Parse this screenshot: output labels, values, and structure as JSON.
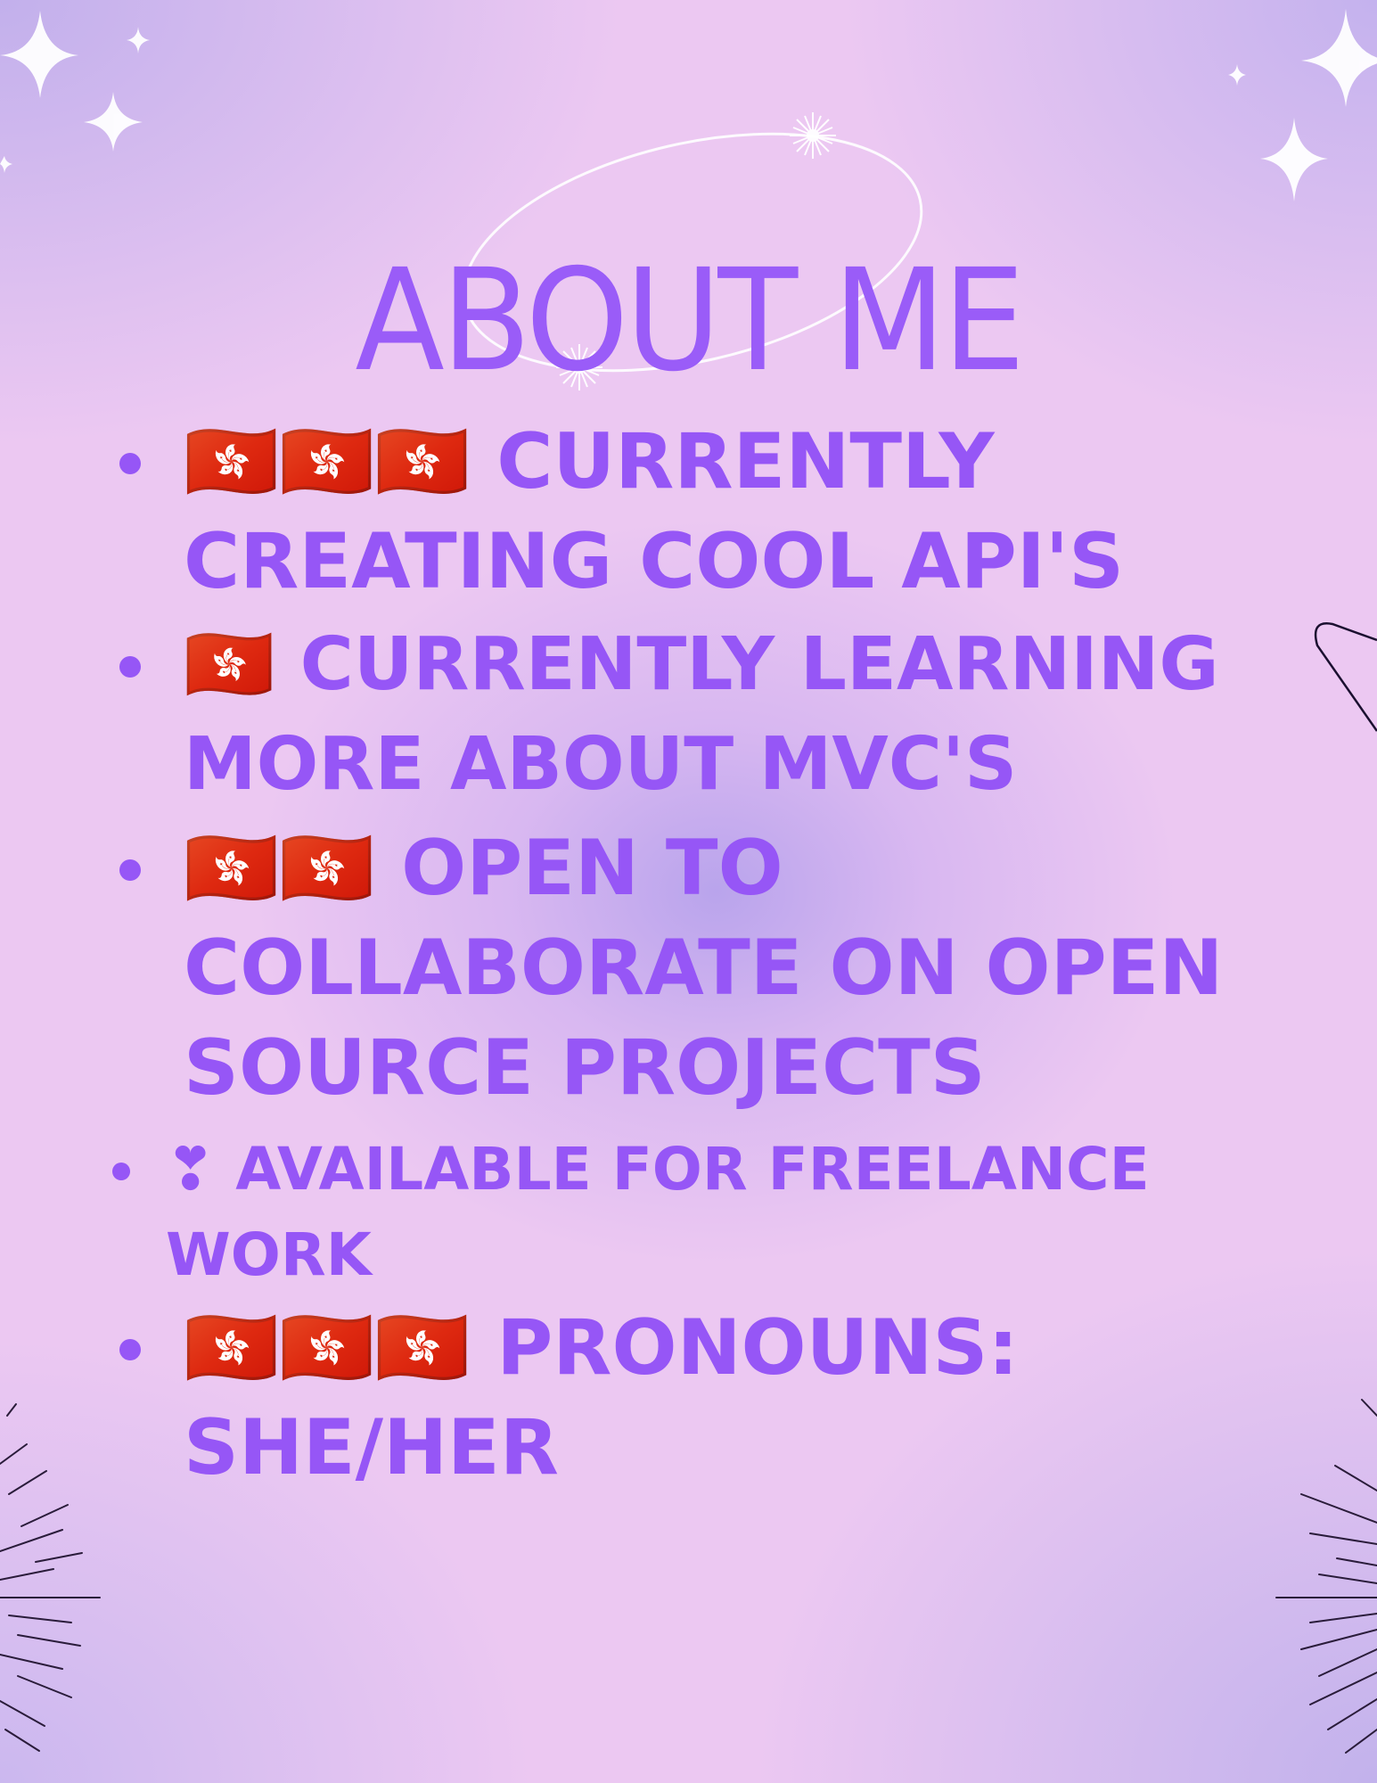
{
  "title": "ABOUT ME",
  "items": [
    {
      "emoji": "🇭🇰🇭🇰🇭🇰",
      "line1": "CURRENTLY",
      "line2": "CREATING COOL API'S",
      "line3": ""
    },
    {
      "emoji": "🇭🇰",
      "line1": "CURRENTLY LEARNING",
      "line2": "MORE ABOUT MVC'S",
      "line3": ""
    },
    {
      "emoji": "🇭🇰🇭🇰",
      "line1": "OPEN TO",
      "line2": "COLLABORATE ON OPEN",
      "line3": "SOURCE PROJECTS"
    },
    {
      "emoji": "❣",
      "line1": "AVAILABLE FOR FREELANCE",
      "line2": "WORK",
      "line3": ""
    },
    {
      "emoji": "🇭🇰🇭🇰🇭🇰",
      "line1": "PRONOUNS:",
      "line2": "SHE/HER",
      "line3": ""
    }
  ],
  "colors": {
    "text": "#9656f6",
    "title": "#9a5cf8",
    "background": "#ecc8f2"
  }
}
